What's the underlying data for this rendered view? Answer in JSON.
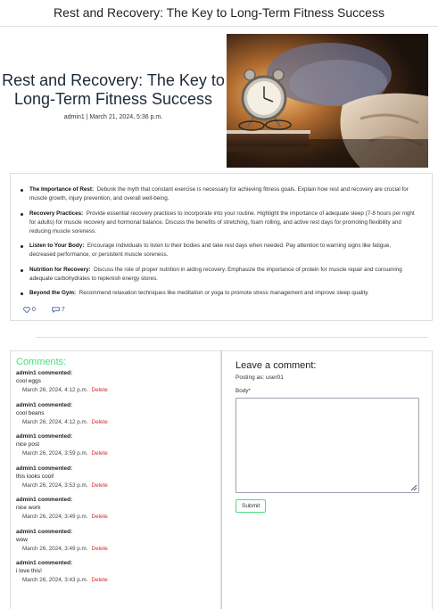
{
  "header": {
    "title": "Rest and Recovery: The Key to Long-Term Fitness Success"
  },
  "post": {
    "title": "Rest and Recovery: The Key to Long-Term Fitness Success",
    "meta": "admin1 | March 21, 2024, 5:36 p.m.",
    "image_icon": "clock-bedside-photo",
    "points": [
      {
        "label": "The Importance of Rest:",
        "text": "Debunk the myth that constant exercise is necessary for achieving fitness goals.  Explain how rest and recovery are crucial for muscle growth, injury prevention, and overall well-being."
      },
      {
        "label": "Recovery Practices:",
        "text": "Provide essential recovery practices to incorporate into your routine.  Highlight the importance of adequate sleep (7-8 hours per night for adults) for muscle recovery and hormonal balance.  Discuss the benefits of stretching, foam rolling, and active rest days for promoting flexibility and reducing muscle soreness."
      },
      {
        "label": "Listen to Your Body:",
        "text": "Encourage individuals to listen to their bodies and take rest days when needed. Pay attention to warning signs like fatigue, decreased performance, or persistent muscle soreness."
      },
      {
        "label": "Nutrition for Recovery:",
        "text": "Discuss the role of proper nutrition in aiding recovery. Emphasize the importance of protein for muscle repair and consuming adequate carbohydrates to replenish energy stores."
      },
      {
        "label": "Beyond the Gym:",
        "text": "Recommend relaxation techniques like meditation or yoga to promote stress management and improve sleep quality."
      }
    ],
    "likes": "0",
    "comments_count": "7",
    "accent_color": "#2c4a8a"
  },
  "comments": {
    "heading": "Comments:",
    "delete_label": "Delete",
    "items": [
      {
        "author": "admin1 commented:",
        "body": "cool eggs",
        "date": "March 26, 2024, 4:12 p.m."
      },
      {
        "author": "admin1 commented:",
        "body": "cool beans",
        "date": "March 26, 2024, 4:12 p.m."
      },
      {
        "author": "admin1 commented:",
        "body": "nice post",
        "date": "March 26, 2024, 3:59 p.m."
      },
      {
        "author": "admin1 commented:",
        "body": "this looks cool!",
        "date": "March 26, 2024, 3:53 p.m."
      },
      {
        "author": "admin1 commented:",
        "body": "nice work",
        "date": "March 26, 2024, 3:49 p.m."
      },
      {
        "author": "admin1 commented:",
        "body": "wow",
        "date": "March 26, 2024, 3:49 p.m."
      },
      {
        "author": "admin1 commented:",
        "body": "i love this!",
        "date": "March 26, 2024, 3:43 p.m."
      }
    ],
    "heading_color": "#4ade80",
    "delete_color": "#dc2626"
  },
  "form": {
    "title": "Leave a comment:",
    "posting_as": "Posting as: user01",
    "body_label": "Body*",
    "body_value": "",
    "submit_label": "Submit"
  }
}
